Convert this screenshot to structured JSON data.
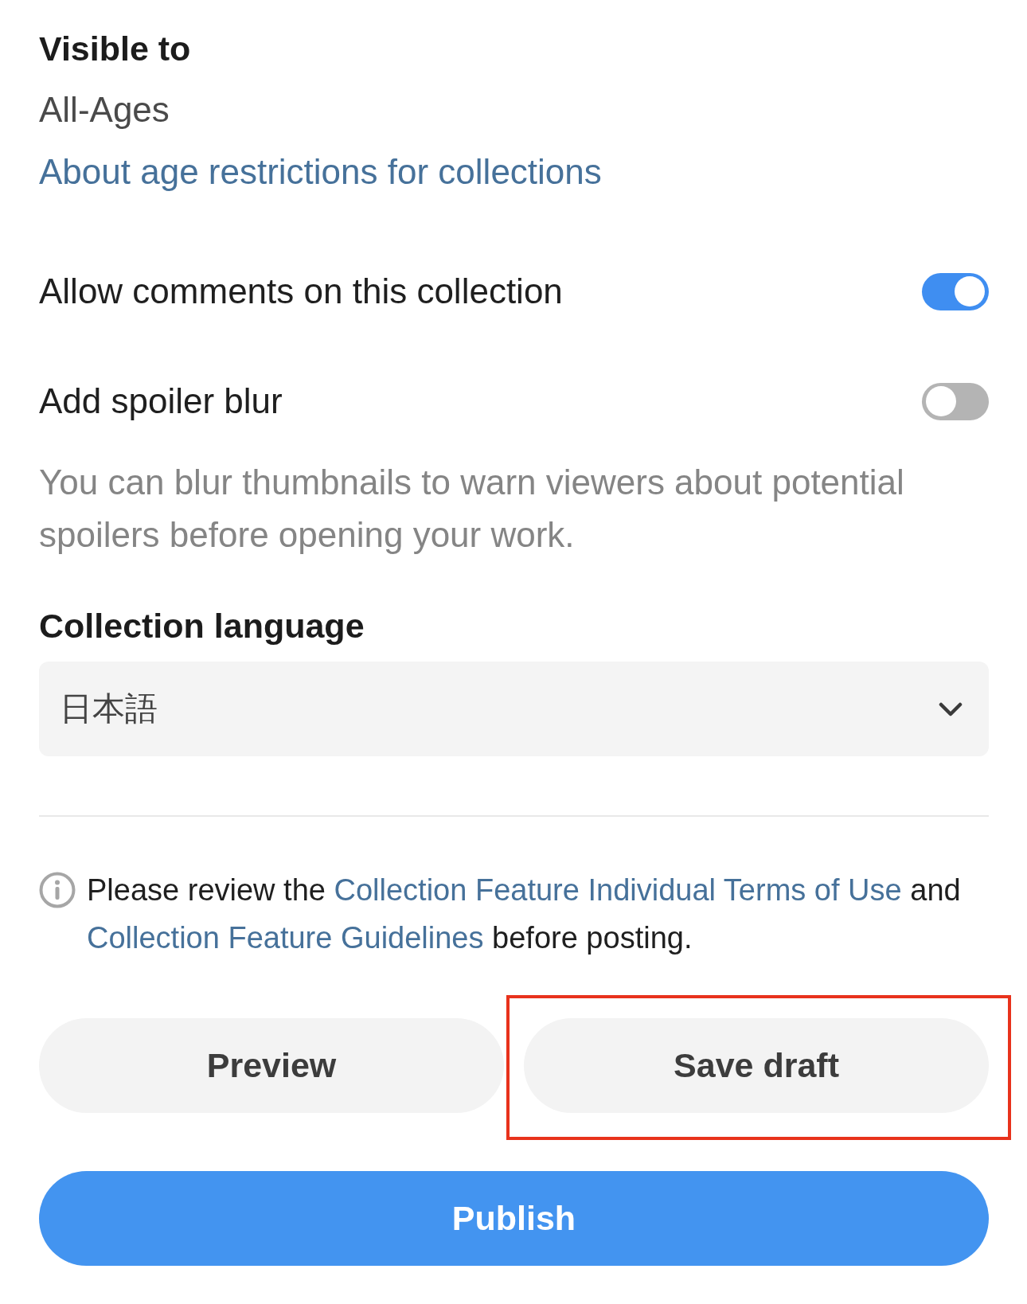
{
  "visibility": {
    "heading": "Visible to",
    "value": "All-Ages",
    "link": "About age restrictions for collections"
  },
  "settings": [
    {
      "label": "Allow comments on this collection",
      "on": true
    },
    {
      "label": "Add spoiler blur",
      "on": false,
      "description": "You can blur thumbnails to warn viewers about potential spoilers before opening your work."
    }
  ],
  "language": {
    "heading": "Collection language",
    "value": "日本語"
  },
  "notice": {
    "parts": [
      {
        "kind": "text",
        "text": "Please review the"
      },
      {
        "kind": "link",
        "text": "Collection Feature Individual Terms of Use"
      },
      {
        "kind": "text",
        "text": "and"
      },
      {
        "kind": "link",
        "text": "Collection Feature Guidelines"
      },
      {
        "kind": "text",
        "text": "before posting."
      }
    ]
  },
  "actions": [
    {
      "label": "Preview",
      "kind": "secondary",
      "highlighted": false
    },
    {
      "label": "Save draft",
      "kind": "secondary",
      "highlighted": true
    },
    {
      "label": "Publish",
      "kind": "primary",
      "highlighted": false
    }
  ]
}
